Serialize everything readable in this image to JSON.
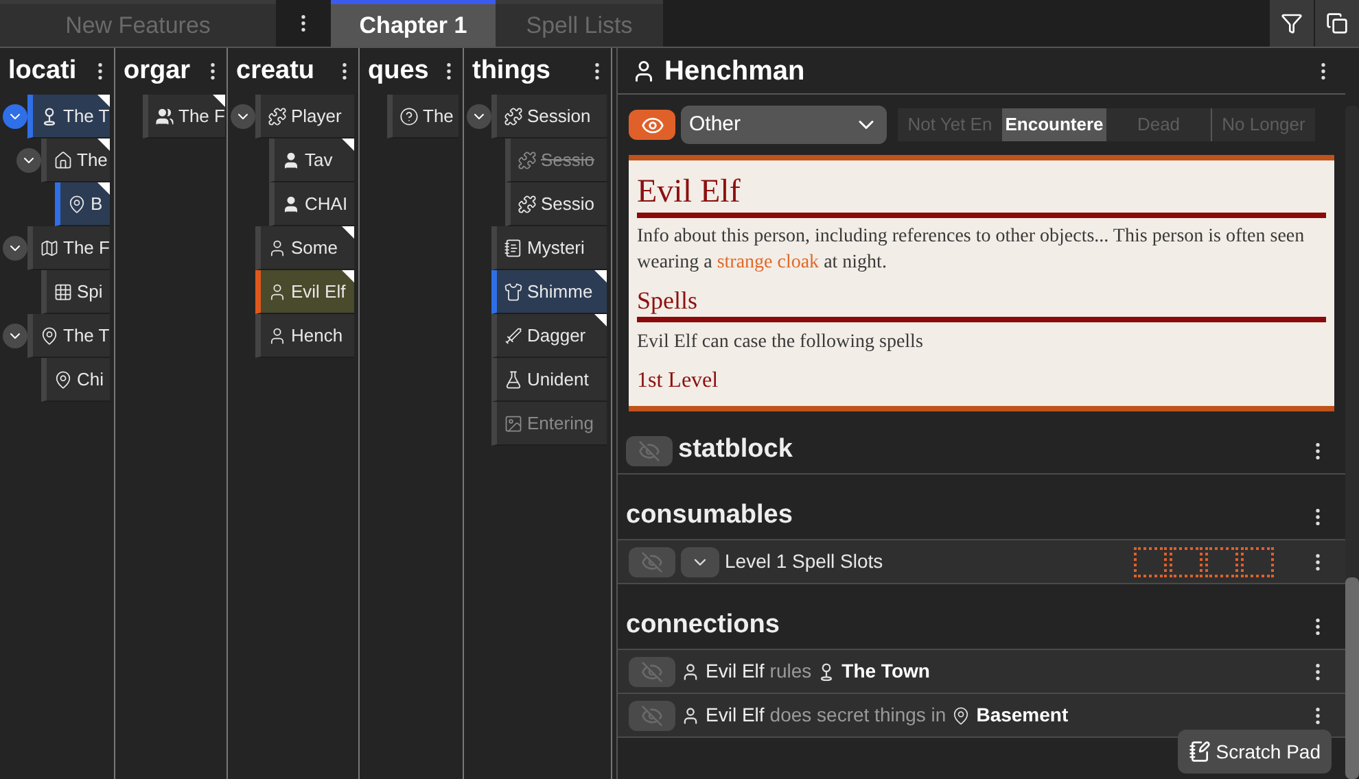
{
  "tabs": [
    {
      "label": "New Features",
      "selected": false
    },
    {
      "label": "Chapter 1",
      "selected": true
    },
    {
      "label": "Spell Lists",
      "selected": false
    }
  ],
  "columns": [
    {
      "title": "locati",
      "items": [
        {
          "label": "The T",
          "kind": "town",
          "selected": true,
          "focused": false,
          "flagged": true,
          "expanded": true,
          "completed": false,
          "disabled": false,
          "children": [
            {
              "label": "The",
              "kind": "building",
              "selected": false,
              "focused": false,
              "flagged": true,
              "expanded": true,
              "completed": false,
              "disabled": false,
              "children": [
                {
                  "label": "B",
                  "kind": "place",
                  "selected": true,
                  "focused": false,
                  "flagged": true,
                  "completed": false,
                  "disabled": false
                }
              ]
            }
          ]
        },
        {
          "label": "The F",
          "kind": "map",
          "selected": false,
          "focused": false,
          "flagged": false,
          "expanded": true,
          "completed": false,
          "disabled": false,
          "children": [
            {
              "label": "Spi",
              "kind": "grid",
              "selected": false,
              "focused": false,
              "flagged": false,
              "completed": false,
              "disabled": false
            }
          ]
        },
        {
          "label": "The T",
          "kind": "place",
          "selected": false,
          "focused": false,
          "flagged": false,
          "expanded": true,
          "completed": false,
          "disabled": false,
          "children": [
            {
              "label": "Chi",
              "kind": "place",
              "selected": false,
              "focused": false,
              "flagged": false,
              "completed": false,
              "disabled": false
            }
          ]
        }
      ]
    },
    {
      "title": "orgar",
      "items": [
        {
          "label": "The F",
          "kind": "group",
          "selected": false,
          "focused": false,
          "flagged": true,
          "completed": false,
          "disabled": false
        }
      ]
    },
    {
      "title": "creatu",
      "items": [
        {
          "label": "Player",
          "kind": "session",
          "selected": false,
          "focused": false,
          "flagged": false,
          "expanded": true,
          "completed": false,
          "disabled": false,
          "children": [
            {
              "label": "Tav",
              "kind": "pc",
              "selected": false,
              "focused": false,
              "flagged": true,
              "completed": false,
              "disabled": false
            },
            {
              "label": "CHAI",
              "kind": "pc",
              "selected": false,
              "focused": false,
              "flagged": false,
              "completed": false,
              "disabled": false
            }
          ]
        },
        {
          "label": "Some",
          "kind": "npc",
          "selected": false,
          "focused": false,
          "flagged": true,
          "completed": false,
          "disabled": false
        },
        {
          "label": "Evil Elf",
          "kind": "npc",
          "selected": false,
          "focused": true,
          "flagged": true,
          "completed": false,
          "disabled": false
        },
        {
          "label": "Hench",
          "kind": "npc",
          "selected": false,
          "focused": false,
          "flagged": false,
          "completed": false,
          "disabled": false
        }
      ]
    },
    {
      "title": "ques",
      "items": [
        {
          "label": "The",
          "kind": "quest",
          "selected": false,
          "focused": false,
          "flagged": false,
          "completed": false,
          "disabled": false
        }
      ]
    },
    {
      "title": "things",
      "items": [
        {
          "label": "Session",
          "kind": "session",
          "selected": false,
          "focused": false,
          "flagged": false,
          "expanded": true,
          "completed": false,
          "disabled": false,
          "children": [
            {
              "label": "Sessio",
              "kind": "session",
              "selected": false,
              "focused": false,
              "flagged": false,
              "completed": true,
              "disabled": false
            },
            {
              "label": "Sessio",
              "kind": "session",
              "selected": false,
              "focused": false,
              "flagged": false,
              "completed": false,
              "disabled": false
            }
          ]
        },
        {
          "label": "Mysteri",
          "kind": "notes",
          "selected": false,
          "focused": false,
          "flagged": false,
          "completed": false,
          "disabled": false
        },
        {
          "label": "Shimme",
          "kind": "shirt",
          "selected": true,
          "focused": false,
          "flagged": true,
          "completed": false,
          "disabled": false
        },
        {
          "label": "Dagger",
          "kind": "dagger",
          "selected": false,
          "focused": false,
          "flagged": true,
          "completed": false,
          "disabled": false
        },
        {
          "label": "Unident",
          "kind": "flask",
          "selected": false,
          "focused": false,
          "flagged": false,
          "completed": false,
          "disabled": false
        },
        {
          "label": "Entering",
          "kind": "image",
          "selected": false,
          "focused": false,
          "flagged": false,
          "completed": false,
          "disabled": true
        }
      ]
    }
  ],
  "detail": {
    "title": "Henchman",
    "visible": true,
    "type_select": {
      "value": "Other"
    },
    "statuses": [
      {
        "label": "Not Yet En",
        "selected": false
      },
      {
        "label": "Encountere",
        "selected": true
      },
      {
        "label": "Dead",
        "selected": false
      },
      {
        "label": "No Longer",
        "selected": false
      }
    ],
    "card": {
      "title": "Evil Elf",
      "text": "Info about this person, including references to other objects... This person is often seen wearing a ",
      "link": "strange cloak",
      "text_end": " at night.",
      "heading": "Spells",
      "subtext": "Evil Elf can case the following spells",
      "level": "1st Level"
    },
    "sections": [
      {
        "title": "statblock",
        "kind": "block",
        "visible": false
      },
      {
        "title": "consumables",
        "kind": "consumables",
        "rows": [
          {
            "label": "Level 1 Spell Slots",
            "visible": false,
            "expanded": false,
            "slots": [
              {
                "checked": false
              },
              {
                "checked": false
              },
              {
                "checked": false
              },
              {
                "checked": false
              }
            ]
          }
        ]
      },
      {
        "title": "connections",
        "kind": "connections",
        "rows": [
          {
            "visible": false,
            "subject": "Evil Elf",
            "relation": "rules",
            "target": "The Town",
            "kind": "town"
          },
          {
            "visible": false,
            "subject": "Evil Elf",
            "relation": "does secret things in",
            "target": "Basement",
            "kind": "place"
          }
        ]
      }
    ]
  },
  "scratch_pad": "Scratch Pad"
}
